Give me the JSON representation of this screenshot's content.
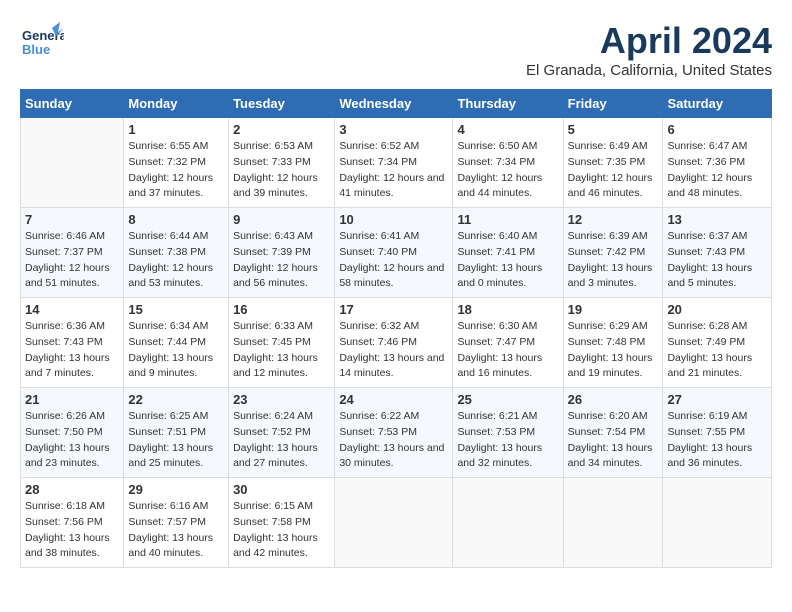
{
  "header": {
    "logo_general": "General",
    "logo_blue": "Blue",
    "month_title": "April 2024",
    "location": "El Granada, California, United States"
  },
  "weekdays": [
    "Sunday",
    "Monday",
    "Tuesday",
    "Wednesday",
    "Thursday",
    "Friday",
    "Saturday"
  ],
  "weeks": [
    [
      null,
      {
        "day": "1",
        "sunrise": "6:55 AM",
        "sunset": "7:32 PM",
        "daylight": "12 hours and 37 minutes."
      },
      {
        "day": "2",
        "sunrise": "6:53 AM",
        "sunset": "7:33 PM",
        "daylight": "12 hours and 39 minutes."
      },
      {
        "day": "3",
        "sunrise": "6:52 AM",
        "sunset": "7:34 PM",
        "daylight": "12 hours and 41 minutes."
      },
      {
        "day": "4",
        "sunrise": "6:50 AM",
        "sunset": "7:34 PM",
        "daylight": "12 hours and 44 minutes."
      },
      {
        "day": "5",
        "sunrise": "6:49 AM",
        "sunset": "7:35 PM",
        "daylight": "12 hours and 46 minutes."
      },
      {
        "day": "6",
        "sunrise": "6:47 AM",
        "sunset": "7:36 PM",
        "daylight": "12 hours and 48 minutes."
      }
    ],
    [
      {
        "day": "7",
        "sunrise": "6:46 AM",
        "sunset": "7:37 PM",
        "daylight": "12 hours and 51 minutes."
      },
      {
        "day": "8",
        "sunrise": "6:44 AM",
        "sunset": "7:38 PM",
        "daylight": "12 hours and 53 minutes."
      },
      {
        "day": "9",
        "sunrise": "6:43 AM",
        "sunset": "7:39 PM",
        "daylight": "12 hours and 56 minutes."
      },
      {
        "day": "10",
        "sunrise": "6:41 AM",
        "sunset": "7:40 PM",
        "daylight": "12 hours and 58 minutes."
      },
      {
        "day": "11",
        "sunrise": "6:40 AM",
        "sunset": "7:41 PM",
        "daylight": "13 hours and 0 minutes."
      },
      {
        "day": "12",
        "sunrise": "6:39 AM",
        "sunset": "7:42 PM",
        "daylight": "13 hours and 3 minutes."
      },
      {
        "day": "13",
        "sunrise": "6:37 AM",
        "sunset": "7:43 PM",
        "daylight": "13 hours and 5 minutes."
      }
    ],
    [
      {
        "day": "14",
        "sunrise": "6:36 AM",
        "sunset": "7:43 PM",
        "daylight": "13 hours and 7 minutes."
      },
      {
        "day": "15",
        "sunrise": "6:34 AM",
        "sunset": "7:44 PM",
        "daylight": "13 hours and 9 minutes."
      },
      {
        "day": "16",
        "sunrise": "6:33 AM",
        "sunset": "7:45 PM",
        "daylight": "13 hours and 12 minutes."
      },
      {
        "day": "17",
        "sunrise": "6:32 AM",
        "sunset": "7:46 PM",
        "daylight": "13 hours and 14 minutes."
      },
      {
        "day": "18",
        "sunrise": "6:30 AM",
        "sunset": "7:47 PM",
        "daylight": "13 hours and 16 minutes."
      },
      {
        "day": "19",
        "sunrise": "6:29 AM",
        "sunset": "7:48 PM",
        "daylight": "13 hours and 19 minutes."
      },
      {
        "day": "20",
        "sunrise": "6:28 AM",
        "sunset": "7:49 PM",
        "daylight": "13 hours and 21 minutes."
      }
    ],
    [
      {
        "day": "21",
        "sunrise": "6:26 AM",
        "sunset": "7:50 PM",
        "daylight": "13 hours and 23 minutes."
      },
      {
        "day": "22",
        "sunrise": "6:25 AM",
        "sunset": "7:51 PM",
        "daylight": "13 hours and 25 minutes."
      },
      {
        "day": "23",
        "sunrise": "6:24 AM",
        "sunset": "7:52 PM",
        "daylight": "13 hours and 27 minutes."
      },
      {
        "day": "24",
        "sunrise": "6:22 AM",
        "sunset": "7:53 PM",
        "daylight": "13 hours and 30 minutes."
      },
      {
        "day": "25",
        "sunrise": "6:21 AM",
        "sunset": "7:53 PM",
        "daylight": "13 hours and 32 minutes."
      },
      {
        "day": "26",
        "sunrise": "6:20 AM",
        "sunset": "7:54 PM",
        "daylight": "13 hours and 34 minutes."
      },
      {
        "day": "27",
        "sunrise": "6:19 AM",
        "sunset": "7:55 PM",
        "daylight": "13 hours and 36 minutes."
      }
    ],
    [
      {
        "day": "28",
        "sunrise": "6:18 AM",
        "sunset": "7:56 PM",
        "daylight": "13 hours and 38 minutes."
      },
      {
        "day": "29",
        "sunrise": "6:16 AM",
        "sunset": "7:57 PM",
        "daylight": "13 hours and 40 minutes."
      },
      {
        "day": "30",
        "sunrise": "6:15 AM",
        "sunset": "7:58 PM",
        "daylight": "13 hours and 42 minutes."
      },
      null,
      null,
      null,
      null
    ]
  ],
  "labels": {
    "sunrise": "Sunrise:",
    "sunset": "Sunset:",
    "daylight": "Daylight:"
  }
}
